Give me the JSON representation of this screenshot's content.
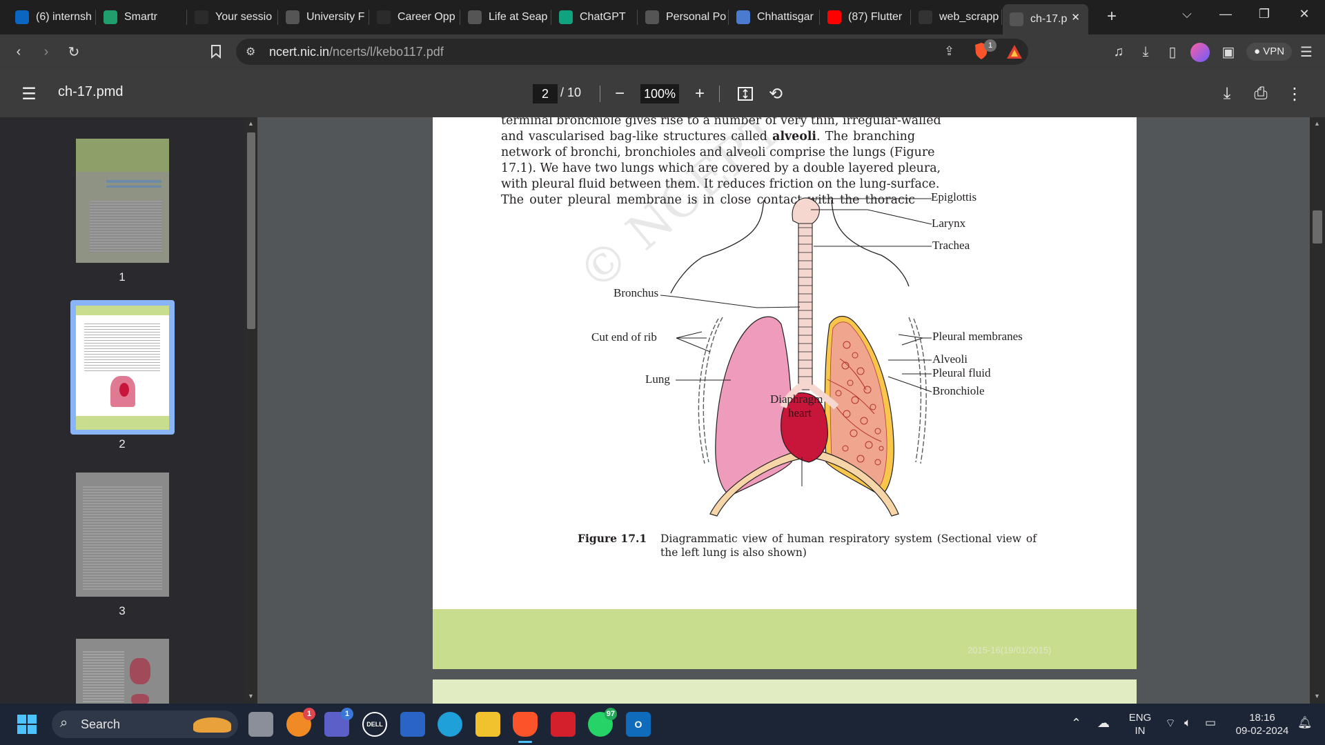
{
  "browser": {
    "tabs": [
      {
        "title": "(6) internsh",
        "icon": "linkedin-icon",
        "color": "#0a66c2"
      },
      {
        "title": "Smartr",
        "icon": "smartr-icon",
        "color": "#1f9e6e"
      },
      {
        "title": "Your sessio",
        "icon": "si-icon",
        "color": "#2b2b2b"
      },
      {
        "title": "University F",
        "icon": "seaport-icon",
        "color": "#555"
      },
      {
        "title": "Career Opp",
        "icon": "si-icon",
        "color": "#2b2b2b"
      },
      {
        "title": "Life at Seap",
        "icon": "seaport-icon",
        "color": "#555"
      },
      {
        "title": "ChatGPT",
        "icon": "chatgpt-icon",
        "color": "#10a37f"
      },
      {
        "title": "Personal Po",
        "icon": "globe-icon",
        "color": "#555"
      },
      {
        "title": "Chhattisgar",
        "icon": "doc-icon",
        "color": "#4a7bd1"
      },
      {
        "title": "(87) Flutter",
        "icon": "youtube-icon",
        "color": "#ff0000"
      },
      {
        "title": "web_scrapp",
        "icon": "github-icon",
        "color": "#333"
      },
      {
        "title": "ch-17.p",
        "icon": "pdf-tab-icon",
        "color": "#555"
      }
    ],
    "url_host": "ncert.nic.in",
    "url_path": "/ncerts/l/kebo117.pdf",
    "vpn_label": "VPN",
    "brave_badge": "1"
  },
  "viewer": {
    "doc_title": "ch-17.pmd",
    "current_page": "2",
    "page_total": "/ 10",
    "zoom": "100%"
  },
  "thumbnails": [
    {
      "label": "1"
    },
    {
      "label": "2"
    },
    {
      "label": "3"
    }
  ],
  "page": {
    "paragraph_lines": [
      "terminal bronchiole gives rise to a number of very thin, irregular-walled",
      "and vascularised bag-like structures called alveoli. The branching",
      "network of bronchi, bronchioles and alveoli comprise the lungs (Figure",
      "17.1). We have two lungs which are covered by a double layered pleura,",
      "with pleural fluid between them. It reduces friction on the lung-surface.",
      "The outer pleural membrane is in close contact with the thoracic"
    ],
    "line2_before": "and vascularised bag-like structures called ",
    "line2_bold": "alveoli",
    "line2_after": ". The branching",
    "figure_labels": {
      "epiglottis": "Epiglottis",
      "larynx": "Larynx",
      "trachea": "Trachea",
      "bronchus": "Bronchus",
      "cut_end_of_rib": "Cut end of rib",
      "pleural_membranes": "Pleural membranes",
      "alveoli": "Alveoli",
      "pleural_fluid": "Pleural fluid",
      "bronchiole": "Bronchiole",
      "lung": "Lung",
      "diaphragm": "Diaphragm",
      "heart": "heart"
    },
    "caption_title": "Figure 17.1",
    "caption_text": "Diagrammatic view of human respiratory system (Sectional view of the left lung is also shown)",
    "footer_date": "2015-16(19/01/2015)",
    "watermark": "© NCERT not to be republished"
  },
  "taskbar": {
    "search_label": "Search",
    "badges": {
      "orange": "1",
      "teams": "1",
      "whatsapp": "97"
    },
    "lang_line1": "ENG",
    "lang_line2": "IN",
    "time": "18:16",
    "date": "09-02-2024"
  }
}
